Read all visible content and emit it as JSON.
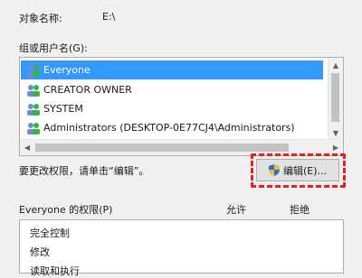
{
  "object": {
    "label": "对象名称:",
    "value": "E:\\"
  },
  "groups": {
    "label": "组或用户名(G):",
    "items": [
      {
        "name": "Everyone",
        "icon": "users-group-icon",
        "selected": true
      },
      {
        "name": "CREATOR OWNER",
        "icon": "users-group-icon",
        "selected": false
      },
      {
        "name": "SYSTEM",
        "icon": "users-group-icon",
        "selected": false
      },
      {
        "name": "Administrators (DESKTOP-0E77CJ4\\Administrators)",
        "icon": "users-group-icon",
        "selected": false
      }
    ]
  },
  "hint": "要更改权限，请单击“编辑”。",
  "edit_button": {
    "label": "编辑(E)...",
    "icon": "uac-shield-icon"
  },
  "permissions": {
    "title": "Everyone 的权限(P)",
    "allow_header": "允许",
    "deny_header": "拒绝",
    "items": [
      "完全控制",
      "修改",
      "读取和执行"
    ]
  },
  "colors": {
    "selection": "#3399ff",
    "highlight": "#e81f1f"
  }
}
